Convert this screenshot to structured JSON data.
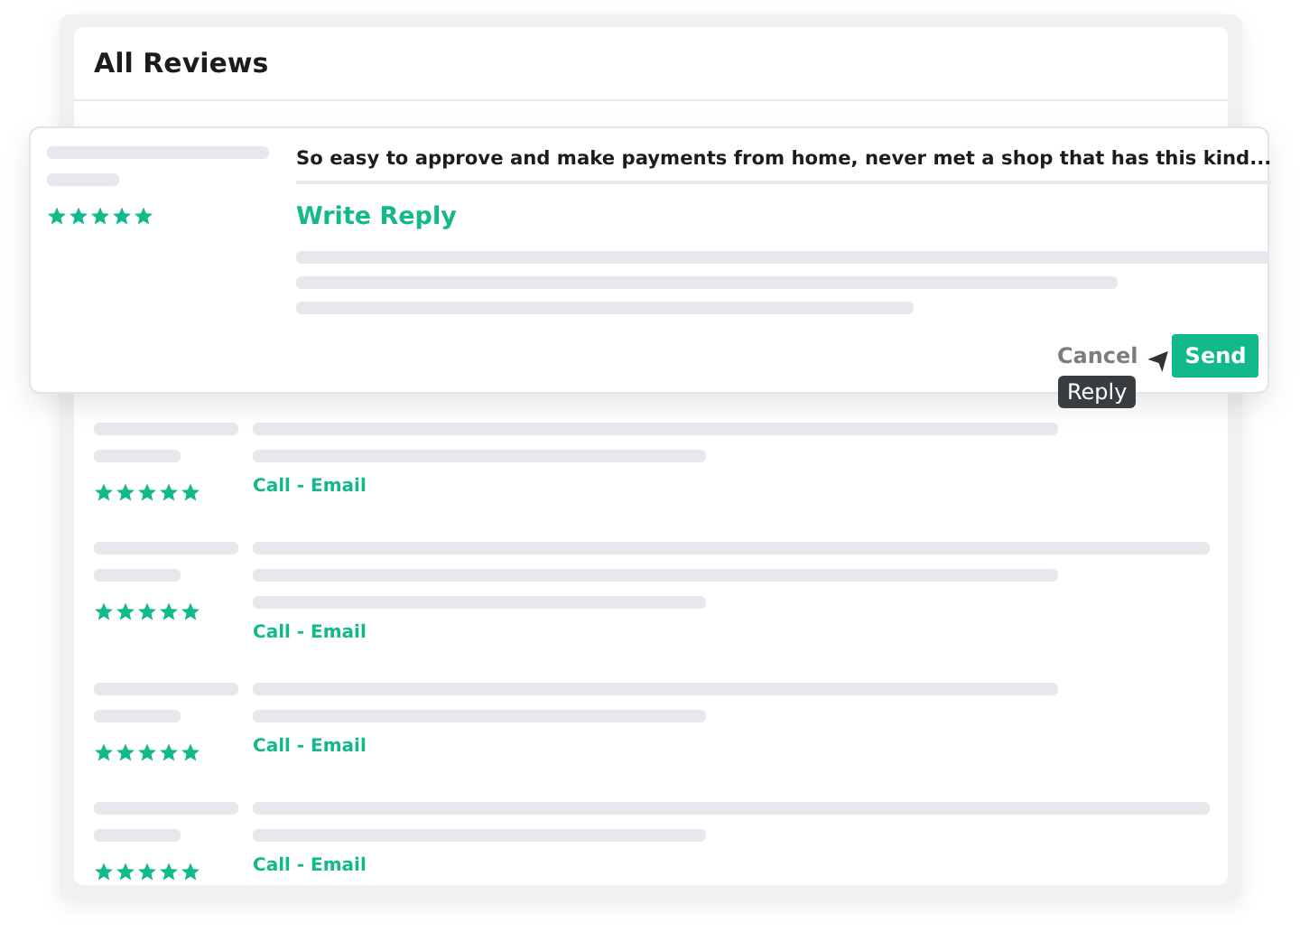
{
  "header": {
    "title": "All Reviews"
  },
  "reply_popup": {
    "stars": 5,
    "review_text": "So easy to approve and make payments from home, never met a shop that has this kind...",
    "heading": "Write Reply",
    "buttons": [
      {
        "label": "Cancel",
        "kind": "text"
      },
      {
        "label": "Send",
        "kind": "primary"
      }
    ],
    "tooltip": "Reply"
  },
  "reviews": [
    {
      "stars": 5,
      "contact_link": "Call - Email"
    },
    {
      "stars": 5,
      "contact_link": "Call - Email"
    },
    {
      "stars": 5,
      "contact_link": "Call - Email"
    },
    {
      "stars": 5,
      "contact_link": "Call - Email"
    }
  ]
}
